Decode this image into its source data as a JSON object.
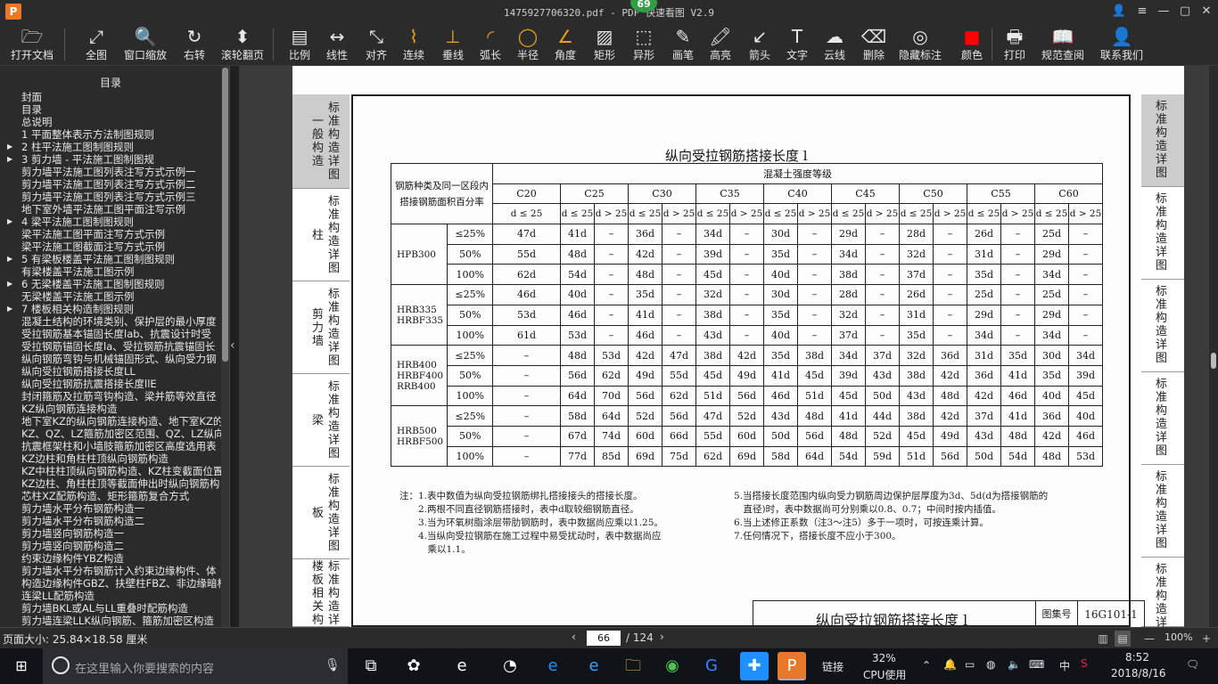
{
  "window": {
    "title": "1475927706320.pdf - PDF 快速看图 V2.9",
    "logo": "P",
    "badge": "69",
    "controls": {
      "user": "👤",
      "menu": "≡",
      "minimize": "—",
      "maximize": "▢",
      "close": "✕"
    }
  },
  "toolbar": [
    {
      "name": "open-file",
      "label": "打开文档",
      "icon": "🗁"
    },
    {
      "name": "fit-all",
      "label": "全图",
      "icon": "⤢"
    },
    {
      "name": "window-zoom",
      "label": "窗口缩放",
      "icon": "🔍"
    },
    {
      "name": "rotate-right",
      "label": "右转",
      "icon": "↻"
    },
    {
      "name": "scroll-page",
      "label": "滚轮翻页",
      "icon": "⬍"
    },
    {
      "name": "scale",
      "label": "比例",
      "icon": "▤"
    },
    {
      "name": "linear",
      "label": "线性",
      "icon": "↔"
    },
    {
      "name": "aligned",
      "label": "对齐",
      "icon": "⤡"
    },
    {
      "name": "continuous",
      "label": "连续",
      "icon": "⌇"
    },
    {
      "name": "perpendicular",
      "label": "垂线",
      "icon": "⊥"
    },
    {
      "name": "arc-length",
      "label": "弧长",
      "icon": "◜"
    },
    {
      "name": "radius",
      "label": "半径",
      "icon": "◯"
    },
    {
      "name": "angle",
      "label": "角度",
      "icon": "∠"
    },
    {
      "name": "rectangle",
      "label": "矩形",
      "icon": "▨"
    },
    {
      "name": "irregular",
      "label": "异形",
      "icon": "⬚"
    },
    {
      "name": "pen",
      "label": "画笔",
      "icon": "✎"
    },
    {
      "name": "highlight",
      "label": "高亮",
      "icon": "🖍"
    },
    {
      "name": "arrow",
      "label": "箭头",
      "icon": "↙"
    },
    {
      "name": "text",
      "label": "文字",
      "icon": "T"
    },
    {
      "name": "cloud",
      "label": "云线",
      "icon": "☁"
    },
    {
      "name": "delete",
      "label": "删除",
      "icon": "⌫"
    },
    {
      "name": "hide-annotations",
      "label": "隐藏标注",
      "icon": "◎"
    },
    {
      "name": "color",
      "label": "颜色",
      "icon": "■"
    },
    {
      "name": "print",
      "label": "打印",
      "icon": "🖶"
    },
    {
      "name": "spec-lookup",
      "label": "规范查阅",
      "icon": "📖"
    },
    {
      "name": "contact-us",
      "label": "联系我们",
      "icon": "👤"
    }
  ],
  "colors": {
    "color_swatch": "#ff0000",
    "toolbar_icon_accent": "#e8a317"
  },
  "sidebar": {
    "title": "目录",
    "items": [
      {
        "label": "封面",
        "expandable": false
      },
      {
        "label": "目录",
        "expandable": false
      },
      {
        "label": "总说明",
        "expandable": false
      },
      {
        "label": "1  平面整体表示方法制图规则",
        "expandable": false
      },
      {
        "label": "2  柱平法施工图制图规则",
        "expandable": true
      },
      {
        "label": "3  剪力墙 - 平法施工图制图规",
        "expandable": true
      },
      {
        "label": "剪力墙平法施工图列表注写方式示例一",
        "expandable": false
      },
      {
        "label": "剪力墙平法施工图列表注写方式示例二",
        "expandable": false
      },
      {
        "label": "剪力墙平法施工图列表注写方式示例三",
        "expandable": false
      },
      {
        "label": "地下室外墙平法施工图平面注写示例",
        "expandable": false
      },
      {
        "label": "4  梁平法施工图制图规则",
        "expandable": true
      },
      {
        "label": "梁平法施工图平面注写方式示例",
        "expandable": false
      },
      {
        "label": "梁平法施工图截面注写方式示例",
        "expandable": false
      },
      {
        "label": "5  有梁板楼盖平法施工图制图规则",
        "expandable": true
      },
      {
        "label": "有梁楼盖平法施工图示例",
        "expandable": false
      },
      {
        "label": "6  无梁楼盖平法施工图制图规则",
        "expandable": true
      },
      {
        "label": "无梁楼盖平法施工图示例",
        "expandable": false
      },
      {
        "label": "7  楼板相关构造制图规则",
        "expandable": true
      },
      {
        "label": "混凝土结构的环境类别、保护层的最小厚度",
        "expandable": false
      },
      {
        "label": "受拉钢筋基本锚固长度lab、抗震设计时受",
        "expandable": false
      },
      {
        "label": "受拉钢筋锚固长度la、受拉钢筋抗震锚固长",
        "expandable": false
      },
      {
        "label": "纵向钢筋弯钩与机械锚固形式、纵向受力钢",
        "expandable": false
      },
      {
        "label": "纵向受拉钢筋搭接长度LL",
        "expandable": false
      },
      {
        "label": "纵向受拉钢筋抗震搭接长度llE",
        "expandable": false
      },
      {
        "label": "封闭箍筋及拉筋弯钩构造、梁并筋等效直径",
        "expandable": false
      },
      {
        "label": "KZ纵向钢筋连接构造",
        "expandable": false
      },
      {
        "label": "地下室KZ的纵向钢筋连接构造、地下室KZ的",
        "expandable": false
      },
      {
        "label": "KZ、QZ、LZ箍筋加密区范围、QZ、LZ纵向钢",
        "expandable": false
      },
      {
        "label": "抗震框架柱和小墙肢箍筋加密区高度选用表",
        "expandable": false
      },
      {
        "label": "KZ边柱和角柱柱顶纵向钢筋构造",
        "expandable": false
      },
      {
        "label": "KZ中柱柱顶纵向钢筋构造、KZ柱变截面位置",
        "expandable": false
      },
      {
        "label": "KZ边柱、角柱柱顶等截面伸出时纵向钢筋构",
        "expandable": false
      },
      {
        "label": "芯柱XZ配筋构造、矩形箍筋复合方式",
        "expandable": false
      },
      {
        "label": "剪力墙水平分布钢筋构造一",
        "expandable": false
      },
      {
        "label": "剪力墙水平分布钢筋构造二",
        "expandable": false
      },
      {
        "label": "剪力墙竖向钢筋构造一",
        "expandable": false
      },
      {
        "label": "剪力墙竖向钢筋构造二",
        "expandable": false
      },
      {
        "label": "约束边缘构件YBZ构造",
        "expandable": false
      },
      {
        "label": "剪力墙水平分布钢筋计入约束边缘构件、体",
        "expandable": false
      },
      {
        "label": "构造边缘构件GBZ、扶壁柱FBZ、非边缘暗柱",
        "expandable": false
      },
      {
        "label": "连梁LL配筋构造",
        "expandable": false
      },
      {
        "label": "剪力墙BKL或AL与LL重叠时配筋构造",
        "expandable": false
      },
      {
        "label": "剪力墙连梁LLK纵向钢筋、箍筋加密区构造",
        "expandable": false
      }
    ],
    "collapse_arrow": "‹"
  },
  "document": {
    "left_tabs": [
      {
        "main": "一般构造",
        "sub": "标准构造详图",
        "active": true
      },
      {
        "main": "柱",
        "sub": "标准构造详图",
        "active": false
      },
      {
        "main": "剪力墙",
        "sub": "标准构造详图",
        "active": false
      },
      {
        "main": "梁",
        "sub": "标准构造详图",
        "active": false
      },
      {
        "main": "板",
        "sub": "标准构造详图",
        "active": false
      },
      {
        "main": "楼板相关构",
        "sub": "标准构造详",
        "active": false
      }
    ],
    "right_tabs": [
      {
        "text": "标准构造详图",
        "active": true
      },
      {
        "text": "标准构造详图",
        "active": false
      },
      {
        "text": "标准构造详图",
        "active": false
      },
      {
        "text": "标准构造详图",
        "active": false
      },
      {
        "text": "标准构造详图",
        "active": false
      },
      {
        "text": "标准构造详",
        "active": false
      }
    ],
    "table_title": "纵向受拉钢筋搭接长度 l",
    "table_title_sub": "l",
    "header": {
      "left": "钢筋种类及同一区段内搭接钢筋面积百分率",
      "group": "混凝土强度等级",
      "grades": [
        "C20",
        "C25",
        "C30",
        "C35",
        "C40",
        "C45",
        "C50",
        "C55",
        "C60"
      ],
      "sub_c20": "d ≤ 25",
      "sub_le": "d ≤ 25",
      "sub_gt": "d > 25"
    },
    "groups": [
      {
        "grade": "HPB300",
        "rows": [
          {
            "ratio": "≤25%",
            "values": [
              "47d",
              "41d",
              "–",
              "36d",
              "–",
              "34d",
              "–",
              "30d",
              "–",
              "29d",
              "–",
              "28d",
              "–",
              "26d",
              "–",
              "25d",
              "–"
            ]
          },
          {
            "ratio": "50%",
            "values": [
              "55d",
              "48d",
              "–",
              "42d",
              "–",
              "39d",
              "–",
              "35d",
              "–",
              "34d",
              "–",
              "32d",
              "–",
              "31d",
              "–",
              "29d",
              "–"
            ]
          },
          {
            "ratio": "100%",
            "values": [
              "62d",
              "54d",
              "–",
              "48d",
              "–",
              "45d",
              "–",
              "40d",
              "–",
              "38d",
              "–",
              "37d",
              "–",
              "35d",
              "–",
              "34d",
              "–"
            ]
          }
        ]
      },
      {
        "grade": "HRB335 HRBF335",
        "rows": [
          {
            "ratio": "≤25%",
            "values": [
              "46d",
              "40d",
              "–",
              "35d",
              "–",
              "32d",
              "–",
              "30d",
              "–",
              "28d",
              "–",
              "26d",
              "–",
              "25d",
              "–",
              "25d",
              "–"
            ]
          },
          {
            "ratio": "50%",
            "values": [
              "53d",
              "46d",
              "–",
              "41d",
              "–",
              "38d",
              "–",
              "35d",
              "–",
              "32d",
              "–",
              "31d",
              "–",
              "29d",
              "–",
              "29d",
              "–"
            ]
          },
          {
            "ratio": "100%",
            "values": [
              "61d",
              "53d",
              "–",
              "46d",
              "–",
              "43d",
              "–",
              "40d",
              "–",
              "37d",
              "–",
              "35d",
              "–",
              "34d",
              "–",
              "34d",
              "–"
            ]
          }
        ]
      },
      {
        "grade": "HRB400 HRBF400 RRB400",
        "rows": [
          {
            "ratio": "≤25%",
            "values": [
              "–",
              "48d",
              "53d",
              "42d",
              "47d",
              "38d",
              "42d",
              "35d",
              "38d",
              "34d",
              "37d",
              "32d",
              "36d",
              "31d",
              "35d",
              "30d",
              "34d"
            ]
          },
          {
            "ratio": "50%",
            "values": [
              "–",
              "56d",
              "62d",
              "49d",
              "55d",
              "45d",
              "49d",
              "41d",
              "45d",
              "39d",
              "43d",
              "38d",
              "42d",
              "36d",
              "41d",
              "35d",
              "39d"
            ]
          },
          {
            "ratio": "100%",
            "values": [
              "–",
              "64d",
              "70d",
              "56d",
              "62d",
              "51d",
              "56d",
              "46d",
              "51d",
              "45d",
              "50d",
              "43d",
              "48d",
              "42d",
              "46d",
              "40d",
              "45d"
            ]
          }
        ]
      },
      {
        "grade": "HRB500 HRBF500",
        "rows": [
          {
            "ratio": "≤25%",
            "values": [
              "–",
              "58d",
              "64d",
              "52d",
              "56d",
              "47d",
              "52d",
              "43d",
              "48d",
              "41d",
              "44d",
              "38d",
              "42d",
              "37d",
              "41d",
              "36d",
              "40d"
            ]
          },
          {
            "ratio": "50%",
            "values": [
              "–",
              "67d",
              "74d",
              "60d",
              "66d",
              "55d",
              "60d",
              "50d",
              "56d",
              "48d",
              "52d",
              "45d",
              "49d",
              "43d",
              "48d",
              "42d",
              "46d"
            ]
          },
          {
            "ratio": "100%",
            "values": [
              "–",
              "77d",
              "85d",
              "69d",
              "75d",
              "62d",
              "69d",
              "58d",
              "64d",
              "54d",
              "59d",
              "51d",
              "56d",
              "50d",
              "54d",
              "48d",
              "53d"
            ]
          }
        ]
      }
    ],
    "notes_left": [
      "注：1.表中数值为纵向受拉钢筋绑扎搭接接头的搭接长度。",
      "　　2.两根不同直径钢筋搭接时，表中d取较细钢筋直径。",
      "　　3.当为环氧树脂涂层带肋钢筋时，表中数据尚应乘以1.25。",
      "　　4.当纵向受拉钢筋在施工过程中易受扰动时，表中数据尚应",
      "　　　乘以1.1。"
    ],
    "notes_right": [
      "5.当搭接长度范围内纵向受力钢筋周边保护层厚度为3d、5d(d为搭接钢筋的",
      "　直径)时，表中数据尚可分别乘以0.8、0.7；中间时按内插值。",
      "6.当上述修正系数（注3～注5）多于一项时，可按连乘计算。",
      "7.任何情况下，搭接长度不应小于300。"
    ],
    "titleblock": {
      "title": "纵向受拉钢筋搭接长度 l",
      "set_label": "图集号",
      "set_no": "16G101-1"
    }
  },
  "statusbar": {
    "page_size": "页面大小: 25.84×18.58 厘米",
    "prev": "‹",
    "current_page": "66",
    "total": "/ 124",
    "next": "›",
    "zoom": "100%",
    "zoom_minus": "—",
    "zoom_plus": "+"
  },
  "taskbar": {
    "search_placeholder": "在这里输入你要搜索的内容",
    "tray": {
      "link": "链接",
      "cpu_percent": "32%",
      "cpu_label": "CPU使用",
      "ime": "中",
      "time": "8:52",
      "date": "2018/8/16"
    }
  }
}
